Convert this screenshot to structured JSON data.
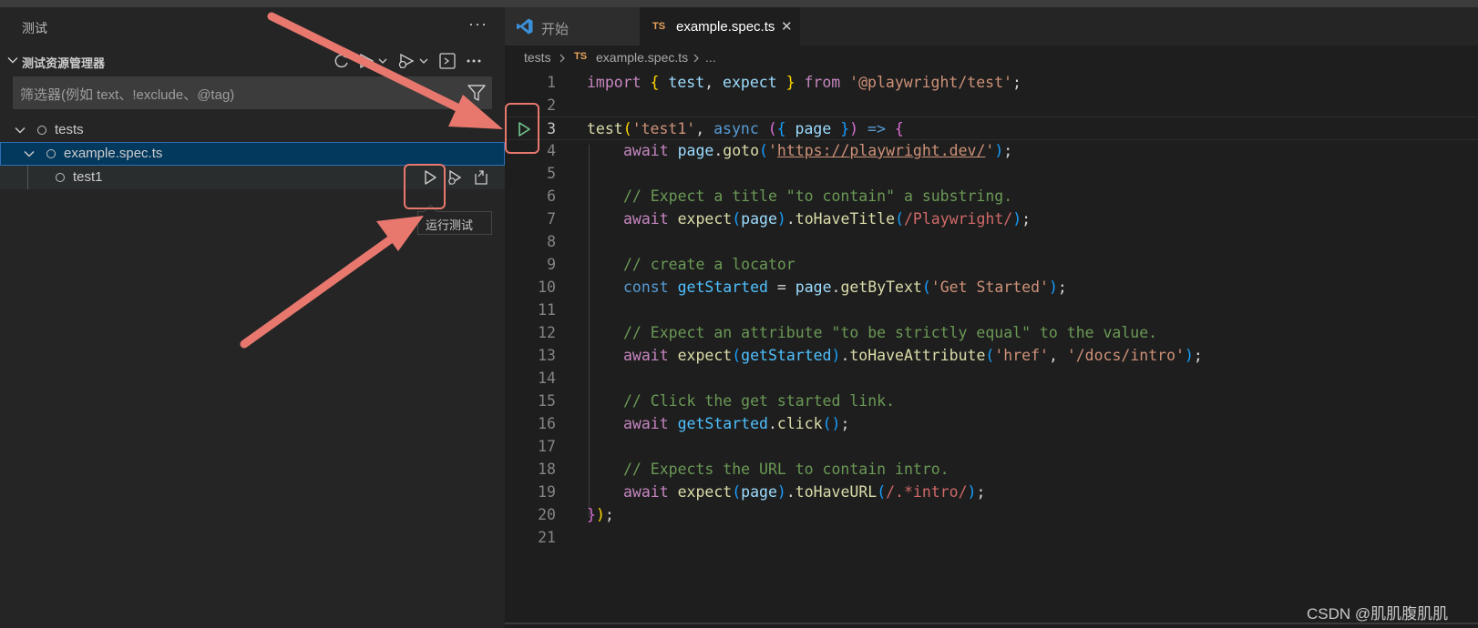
{
  "sidebar": {
    "title": "测试",
    "more_label": "···",
    "explorer_title": "测试资源管理器",
    "filter_placeholder": "筛选器(例如 text、!exclude、@tag)",
    "tree": {
      "folder": "tests",
      "file": "example.spec.ts",
      "test": "test1"
    },
    "tooltip": "运行测试"
  },
  "editor": {
    "tabs": [
      {
        "label": "开始",
        "icon": "vscode-logo-icon"
      },
      {
        "label": "example.spec.ts",
        "badge": "TS",
        "close": "✕"
      }
    ],
    "breadcrumb": {
      "folder": "tests",
      "badge": "TS",
      "file": "example.spec.ts",
      "rest": "..."
    },
    "line_numbers": [
      "1",
      "2",
      "3",
      "4",
      "5",
      "6",
      "7",
      "8",
      "9",
      "10",
      "11",
      "12",
      "13",
      "14",
      "15",
      "16",
      "17",
      "18",
      "19",
      "20",
      "21"
    ],
    "code": {
      "l1": [
        "import",
        "{",
        "test",
        ",",
        "expect",
        "}",
        "from",
        "'@playwright/test'",
        ";"
      ],
      "l3": [
        "test",
        "(",
        "'test1'",
        ",",
        "async",
        "(",
        "{",
        "page",
        "}",
        ")",
        "=>",
        "{"
      ],
      "l4": [
        "await",
        "page",
        ".",
        "goto",
        "(",
        "'",
        "https://playwright.dev/",
        "'",
        ")",
        ";"
      ],
      "l6": "// Expect a title \"to contain\" a substring.",
      "l7": [
        "await",
        "expect",
        "(",
        "page",
        ")",
        ".",
        "toHaveTitle",
        "(",
        "/Playwright/",
        ")",
        ";"
      ],
      "l9": "// create a locator",
      "l10": [
        "const",
        "getStarted",
        "=",
        "page",
        ".",
        "getByText",
        "(",
        "'Get Started'",
        ")",
        ";"
      ],
      "l12": "// Expect an attribute \"to be strictly equal\" to the value.",
      "l13": [
        "await",
        "expect",
        "(",
        "getStarted",
        ")",
        ".",
        "toHaveAttribute",
        "(",
        "'href'",
        ",",
        "'/docs/intro'",
        ")",
        ";"
      ],
      "l15": "// Click the get started link.",
      "l16": [
        "await",
        "getStarted",
        ".",
        "click",
        "()",
        ";"
      ],
      "l18": "// Expects the URL to contain intro.",
      "l19": [
        "await",
        "expect",
        "(",
        "page",
        ")",
        ".",
        "toHaveURL",
        "(",
        "/.*intro/",
        ")",
        ";"
      ],
      "l20": [
        "}",
        ")",
        ";"
      ]
    }
  },
  "watermark": "CSDN @肌肌腹肌肌",
  "colors": {
    "annotation": "#e8786e",
    "selection": "#04395e",
    "run_green": "#73c991"
  }
}
